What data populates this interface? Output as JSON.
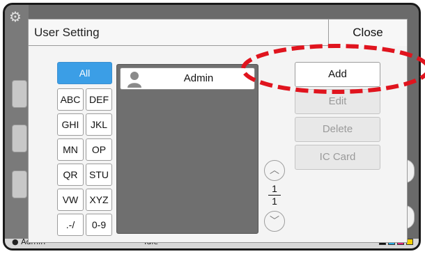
{
  "background": {
    "status_user": "Admin",
    "status_state": "Idle",
    "ink_colors": [
      "#111111",
      "#27a8e0",
      "#e0287a",
      "#f5d000"
    ]
  },
  "dialog": {
    "title": "User Setting",
    "close_label": "Close"
  },
  "filters": {
    "all": "All",
    "abc": "ABC",
    "def": "DEF",
    "ghi": "GHI",
    "jkl": "JKL",
    "mn": "MN",
    "op": "OP",
    "qr": "QR",
    "stu": "STU",
    "vw": "VW",
    "xyz": "XYZ",
    "sym": ".-/",
    "num": "0-9",
    "selected": "All"
  },
  "user_list": {
    "items": [
      {
        "name": "Admin",
        "icon": "person-icon"
      }
    ]
  },
  "pager": {
    "current": "1",
    "total": "1"
  },
  "actions": {
    "add": "Add",
    "edit": "Edit",
    "delete": "Delete",
    "ic_card": "IC Card"
  },
  "annotation": {
    "color": "#e0141e",
    "style": "dashed-oval"
  },
  "colors": {
    "accent": "#3b9ee6",
    "frame": "#1a1a1a"
  }
}
